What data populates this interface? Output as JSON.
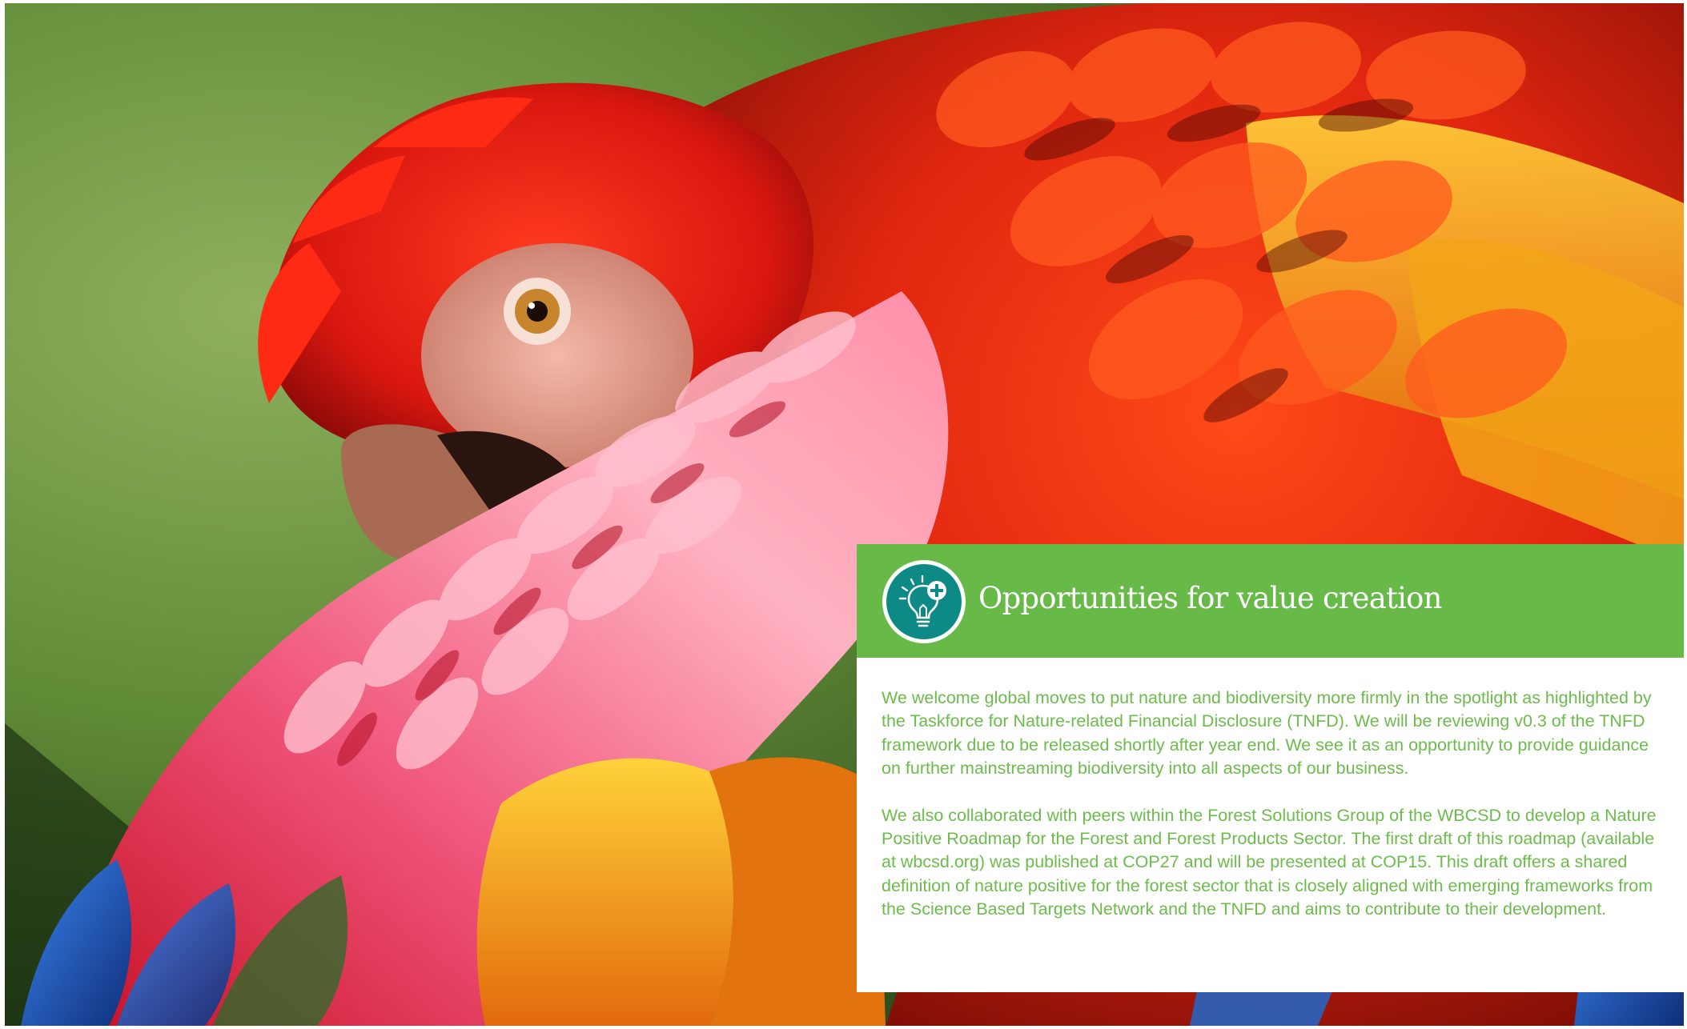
{
  "photo": {
    "subject": "scarlet macaw preening its feathers",
    "colors": {
      "background_green": "#5e8a38",
      "feather_red": "#d8170f",
      "feather_orange": "#f07a12",
      "feather_yellow": "#f2c21b",
      "feather_pink": "#f06a8c",
      "feather_blue": "#1f5fc8"
    }
  },
  "callout": {
    "icon": "lightbulb-plus-icon",
    "title": "Opportunities for value creation",
    "paragraphs": [
      "We welcome global moves to put nature and biodiversity more firmly in the spotlight as highlighted by the Taskforce for Nature-related Financial Disclosure (TNFD). We will be reviewing v0.3 of the TNFD framework due to be released shortly after year end. We see it as an opportunity to provide guidance on further mainstreaming biodiversity into all aspects of our business.",
      "We also collaborated with peers within the Forest Solutions Group of the WBCSD to develop a Nature Positive Roadmap for the Forest and Forest Products Sector. The first draft of this roadmap (available at wbcsd.org) was published at COP27 and will be presented at COP15. This draft offers a shared definition of nature positive for the forest sector that is closely aligned with emerging frameworks from the Science Based Targets Network and the TNFD and aims to contribute to their development."
    ],
    "colors": {
      "header_bg": "#67ba47",
      "icon_circle": "#0e8a86",
      "body_text": "#6cbc4c"
    }
  }
}
